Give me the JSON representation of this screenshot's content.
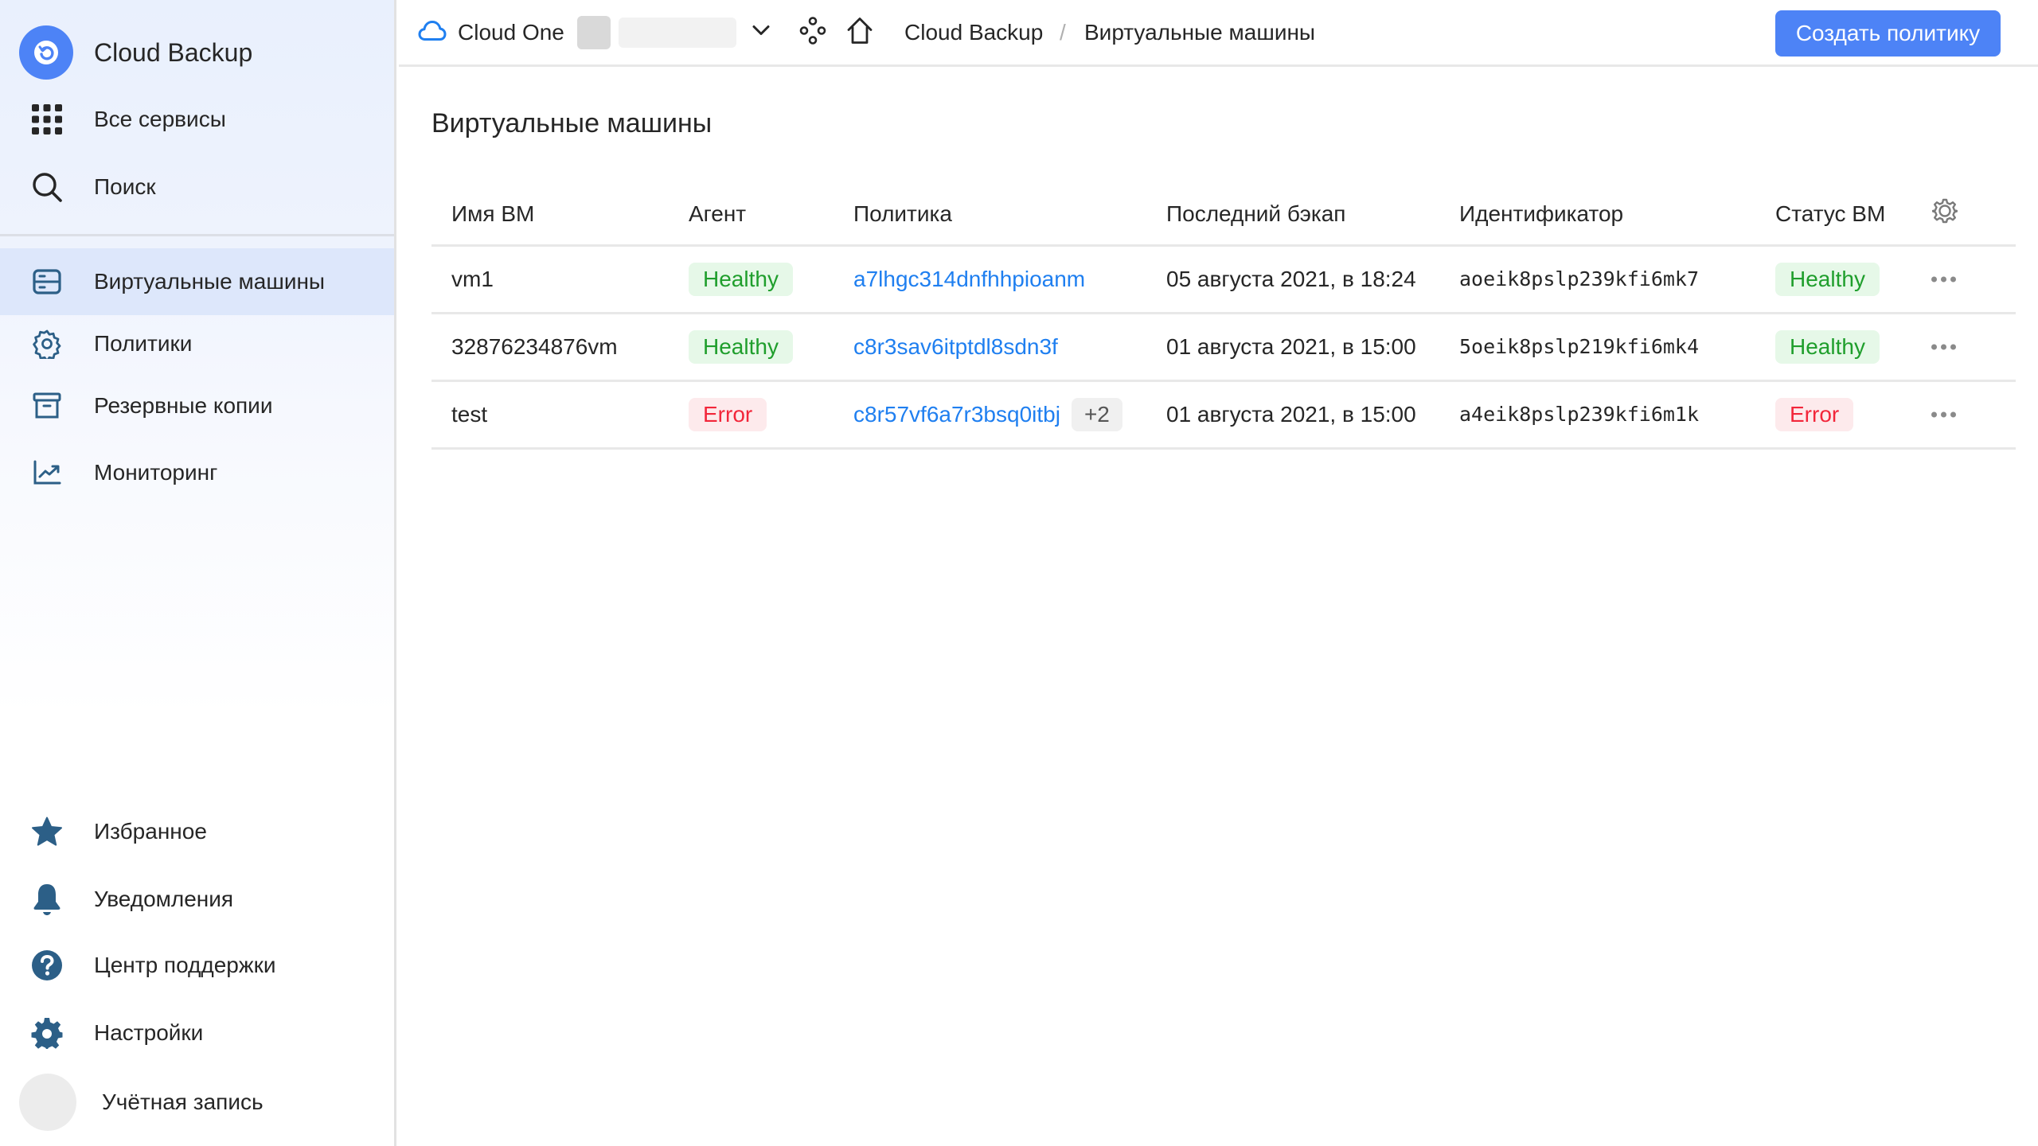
{
  "sidebar": {
    "service_title": "Cloud Backup",
    "top_items": [
      {
        "id": "all-services",
        "label": "Все сервисы",
        "icon": "grid-icon"
      },
      {
        "id": "search",
        "label": "Поиск",
        "icon": "search-icon"
      }
    ],
    "nav_items": [
      {
        "id": "virtual-machines",
        "label": "Виртуальные машины",
        "icon": "server-icon",
        "active": true
      },
      {
        "id": "policies",
        "label": "Политики",
        "icon": "gear-outline-icon"
      },
      {
        "id": "backups",
        "label": "Резервные копии",
        "icon": "archive-icon"
      },
      {
        "id": "monitoring",
        "label": "Мониторинг",
        "icon": "chart-icon"
      }
    ],
    "bottom_items": [
      {
        "id": "favorites",
        "label": "Избранное",
        "icon": "star-icon"
      },
      {
        "id": "notifications",
        "label": "Уведомления",
        "icon": "bell-icon"
      },
      {
        "id": "support",
        "label": "Центр поддержки",
        "icon": "help-icon"
      },
      {
        "id": "settings",
        "label": "Настройки",
        "icon": "gear-icon"
      },
      {
        "id": "account",
        "label": "Учётная запись",
        "icon": "avatar"
      }
    ],
    "icon_color": "#2c5f87",
    "accent": "#4d83f6"
  },
  "header": {
    "cloud_name": "Cloud One",
    "breadcrumb": [
      "Cloud Backup",
      "Виртуальные машины"
    ],
    "separator": "/",
    "primary_button": "Создать политику"
  },
  "page": {
    "title": "Виртуальные машины"
  },
  "table": {
    "columns": [
      "Имя ВМ",
      "Агент",
      "Политика",
      "Последний бэкап",
      "Идентификатор",
      "Статус ВМ"
    ],
    "rows": [
      {
        "name": "vm1",
        "agent": "Healthy",
        "agent_status": "healthy",
        "policy": "a7lhgc314dnfhhpioanm",
        "policy_more": "",
        "last_backup": "05 августа 2021, в 18:24",
        "id": "aoeik8pslp239kfi6mk7",
        "status": "Healthy",
        "status_type": "healthy"
      },
      {
        "name": "32876234876vm",
        "agent": "Healthy",
        "agent_status": "healthy",
        "policy": "c8r3sav6itptdl8sdn3f",
        "policy_more": "",
        "last_backup": "01 августа 2021, в 15:00",
        "id": "5oeik8pslp219kfi6mk4",
        "status": "Healthy",
        "status_type": "healthy"
      },
      {
        "name": "test",
        "agent": "Error",
        "agent_status": "error",
        "policy": "c8r57vf6a7r3bsq0itbj",
        "policy_more": "+2",
        "last_backup": "01 августа 2021, в 15:00",
        "id": "a4eik8pslp239kfi6m1k",
        "status": "Error",
        "status_type": "error"
      }
    ]
  },
  "colors": {
    "primary": "#4d83f6",
    "link": "#1f7ff0",
    "healthy_text": "#1f9e2c",
    "healthy_bg": "#e6f8e8",
    "error_text": "#f2263a",
    "error_bg": "#fdeaec"
  }
}
